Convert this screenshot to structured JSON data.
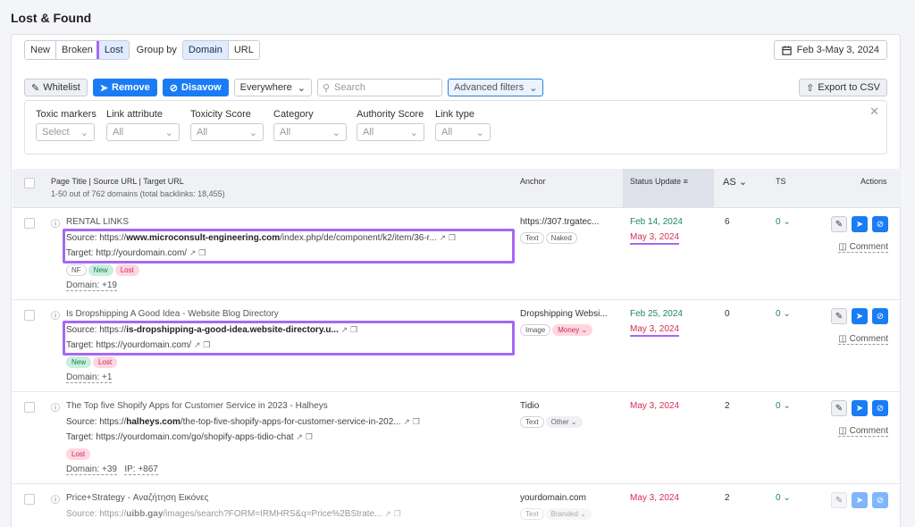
{
  "page": {
    "title": "Lost & Found"
  },
  "filter_bar": {
    "tabs": [
      "New",
      "Broken",
      "Lost"
    ],
    "group_by_label": "Group by",
    "group_options": [
      "Domain",
      "URL"
    ],
    "date_range": "Feb 3-May 3, 2024"
  },
  "toolbar": {
    "whitelist": "Whitelist",
    "remove": "Remove",
    "disavow": "Disavow",
    "scope": "Everywhere",
    "search_placeholder": "Search",
    "advanced": "Advanced filters",
    "export": "Export to CSV"
  },
  "filters": [
    {
      "label": "Toxic markers",
      "value": "Select"
    },
    {
      "label": "Link attribute",
      "value": "All"
    },
    {
      "label": "Toxicity Score",
      "value": "All"
    },
    {
      "label": "Category",
      "value": "All"
    },
    {
      "label": "Authority Score",
      "value": "All"
    },
    {
      "label": "Link type",
      "value": "All"
    }
  ],
  "table": {
    "col_page": "Page Title | Source URL | Target URL",
    "summary": "1-50 out of 762 domains (total backlinks: 18,455)",
    "col_anchor": "Anchor",
    "col_status": "Status Update",
    "col_as": "AS",
    "col_ts": "TS",
    "col_actions": "Actions",
    "comment_label": "Comment",
    "rows": [
      {
        "title": "RENTAL LINKS",
        "source_prefix": "Source: https://",
        "source_bold": "www.microconsult-engineering.com",
        "source_rest": "/index.php/de/component/k2/item/36-r...",
        "target": "Target: http://yourdomain.com/",
        "tags": [
          "NF",
          "New",
          "Lost"
        ],
        "domain": "Domain: +19",
        "ip": "",
        "anchor": "https://307.trgatec...",
        "anchor_tags": [
          "Text",
          "Naked"
        ],
        "date1": "Feb 14, 2024",
        "date2": "May 3, 2024",
        "as": "6",
        "ts": "0"
      },
      {
        "title": "Is Dropshipping A Good Idea - Website Blog Directory",
        "source_prefix": "Source: https://",
        "source_bold": "is-dropshipping-a-good-idea.website-directory.u...",
        "source_rest": "",
        "target": "Target: https://yourdomain.com/",
        "tags": [
          "New",
          "Lost"
        ],
        "domain": "Domain: +1",
        "ip": "",
        "anchor": "Dropshipping Websi...",
        "anchor_tags": [
          "Image",
          "Money"
        ],
        "date1": "Feb 25, 2024",
        "date2": "May 3, 2024",
        "as": "0",
        "ts": "0"
      },
      {
        "title": "The Top five Shopify Apps for Customer Service in 2023 - Halheys",
        "source_prefix": "Source: https://",
        "source_bold": "halheys.com",
        "source_rest": "/the-top-five-shopify-apps-for-customer-service-in-202...",
        "target": "Target: https://yourdomain.com/go/shopify-apps-tidio-chat",
        "tags": [
          "Lost"
        ],
        "domain": "Domain: +39",
        "ip": "IP: +867",
        "anchor": "Tidio",
        "anchor_tags": [
          "Text",
          "Other"
        ],
        "date1": "",
        "date2": "May 3, 2024",
        "as": "2",
        "ts": "0"
      },
      {
        "title": "Price+Strategy - Αναζήτηση Εικόνες",
        "source_prefix": "Source: https://",
        "source_bold": "uibb.gay",
        "source_rest": "/images/search?FORM=IRMHRS&q=Price%2BStrate...",
        "target": "",
        "tags": [],
        "domain": "",
        "ip": "",
        "anchor": "yourdomain.com",
        "anchor_tags": [
          "Text",
          "Branded"
        ],
        "date1": "",
        "date2": "May 3, 2024",
        "as": "2",
        "ts": "0"
      }
    ]
  }
}
